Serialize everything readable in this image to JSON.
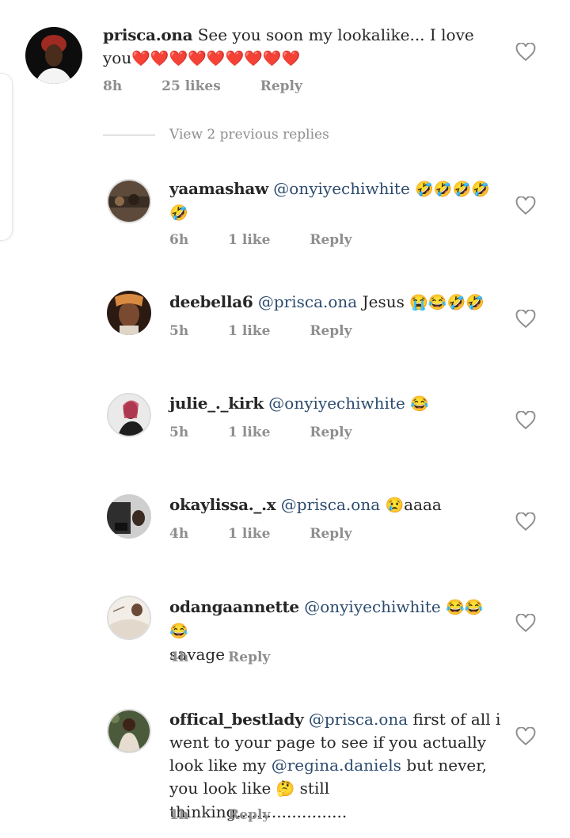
{
  "comments": [
    {
      "username": "prisca.ona",
      "mention": "",
      "text": "See you soon my lookalike... I love you",
      "emoji": "❤️❤️❤️❤️❤️❤️❤️❤️❤️",
      "time": "8h",
      "likes": "25 likes",
      "reply": "Reply"
    },
    {
      "username": "yaamashaw",
      "mention": "@onyiyechiwhite",
      "text": "",
      "emoji": "🤣🤣🤣🤣🤣",
      "time": "6h",
      "likes": "1 like",
      "reply": "Reply"
    },
    {
      "username": "deebella6",
      "mention": "@prisca.ona",
      "text": "Jesus",
      "emoji": "😭😂🤣🤣",
      "time": "5h",
      "likes": "1 like",
      "reply": "Reply"
    },
    {
      "username": "julie_._kirk",
      "mention": "@onyiyechiwhite",
      "text": "",
      "emoji": "😂",
      "time": "5h",
      "likes": "1 like",
      "reply": "Reply"
    },
    {
      "username": "okaylissa._.x",
      "mention": "@prisca.ona",
      "text": "",
      "emoji": "😢",
      "text_after": "aaaa",
      "time": "4h",
      "likes": "1 like",
      "reply": "Reply"
    },
    {
      "username": "odangaannette",
      "mention": "@onyiyechiwhite",
      "text": "",
      "emoji": "😂😂😂",
      "text_after": "savage",
      "time": "4h",
      "likes": "",
      "reply": "Reply"
    },
    {
      "username": "offical_bestlady",
      "mention": "@prisca.ona",
      "text": " first of all i went to your page to see if you actually look like my",
      "mention2": "@regina.daniels",
      "text2": "but never, you look like",
      "emoji": "🤔",
      "text_after": "still thinking......................",
      "time": "1h",
      "likes": "",
      "reply": "Reply"
    }
  ],
  "view_previous": "View 2 previous replies",
  "colors": {
    "mention": "#2c4b6e",
    "meta": "#8e8e8e",
    "text": "#262626"
  },
  "icons": {
    "like": "heart-outline-icon"
  }
}
